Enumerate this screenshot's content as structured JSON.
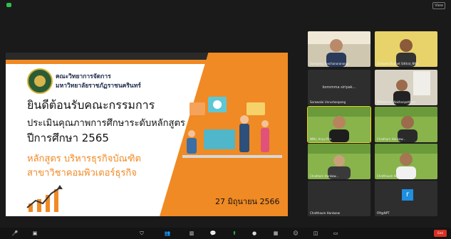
{
  "topbar": {
    "view_label": "View"
  },
  "slide": {
    "faculty": "คณะวิทยาการจัดการ",
    "university": "มหาวิทยาลัยราชภัฏราชนครินทร์",
    "title_line1": "ยินดีต้อนรับคณะกรรมการ",
    "title_line2": "ประเมินคุณภาพการศึกษาระดับหลักสูตร",
    "title_line3": "ปีการศึกษา 2565",
    "program_line1": "หลักสูตร บริหารธุรกิจบัณฑิต",
    "program_line2": "สาขาวิชาคอมพิวเตอร์ธุรกิจ",
    "date": "27 มิถุนายน 2566"
  },
  "participants": [
    {
      "label": "Sompong Taechanoranongs"
    },
    {
      "label": "Donaent Buphet Sitthat_NNU"
    },
    {
      "label": "boromma siripak..."
    },
    {
      "label": "Sorawalai Unrushanpong"
    },
    {
      "label": "Mittokomb_Nakhonpathum"
    },
    {
      "label": "NNU, Ariya Pim"
    },
    {
      "label": "Chadhorn Hankaw..."
    },
    {
      "label": "Chadhorn Hankaw..."
    },
    {
      "label": "Chatthaum Hankaew"
    },
    {
      "label": "FM@NPT"
    }
  ],
  "rlabel": "r",
  "toolbar": {
    "end_label": "End"
  },
  "colors": {
    "accent": "#f08a24",
    "navy": "#1b2a4a",
    "end": "#d93025"
  }
}
